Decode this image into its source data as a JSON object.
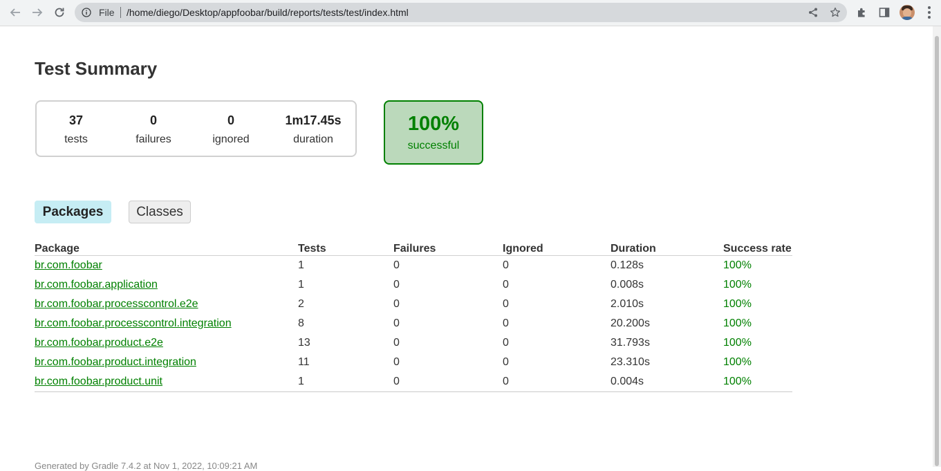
{
  "browser": {
    "omnibox": {
      "scheme_label": "File",
      "url": "/home/diego/Desktop/appfoobar/build/reports/tests/test/index.html"
    }
  },
  "page": {
    "title": "Test Summary",
    "summary": {
      "tests": {
        "value": "37",
        "label": "tests"
      },
      "failures": {
        "value": "0",
        "label": "failures"
      },
      "ignored": {
        "value": "0",
        "label": "ignored"
      },
      "duration": {
        "value": "1m17.45s",
        "label": "duration"
      }
    },
    "success": {
      "value": "100%",
      "label": "successful",
      "color": "#008000"
    },
    "tabs": [
      {
        "label": "Packages",
        "active": true
      },
      {
        "label": "Classes",
        "active": false
      }
    ],
    "table": {
      "headers": [
        "Package",
        "Tests",
        "Failures",
        "Ignored",
        "Duration",
        "Success rate"
      ],
      "rows": [
        {
          "package": "br.com.foobar",
          "tests": "1",
          "failures": "0",
          "ignored": "0",
          "duration": "0.128s",
          "rate": "100%"
        },
        {
          "package": "br.com.foobar.application",
          "tests": "1",
          "failures": "0",
          "ignored": "0",
          "duration": "0.008s",
          "rate": "100%"
        },
        {
          "package": "br.com.foobar.processcontrol.e2e",
          "tests": "2",
          "failures": "0",
          "ignored": "0",
          "duration": "2.010s",
          "rate": "100%"
        },
        {
          "package": "br.com.foobar.processcontrol.integration",
          "tests": "8",
          "failures": "0",
          "ignored": "0",
          "duration": "20.200s",
          "rate": "100%"
        },
        {
          "package": "br.com.foobar.product.e2e",
          "tests": "13",
          "failures": "0",
          "ignored": "0",
          "duration": "31.793s",
          "rate": "100%"
        },
        {
          "package": "br.com.foobar.product.integration",
          "tests": "11",
          "failures": "0",
          "ignored": "0",
          "duration": "23.310s",
          "rate": "100%"
        },
        {
          "package": "br.com.foobar.product.unit",
          "tests": "1",
          "failures": "0",
          "ignored": "0",
          "duration": "0.004s",
          "rate": "100%"
        }
      ]
    },
    "footer": "Generated by Gradle 7.4.2 at Nov 1, 2022, 10:09:21 AM"
  },
  "icons": {
    "back": "arrow-left-icon",
    "forward": "arrow-right-icon",
    "reload": "reload-icon",
    "info": "info-icon",
    "share": "share-icon",
    "bookmark": "star-icon",
    "extensions": "puzzle-icon",
    "side_panel": "side-panel-icon",
    "menu": "kebab-menu-icon"
  }
}
